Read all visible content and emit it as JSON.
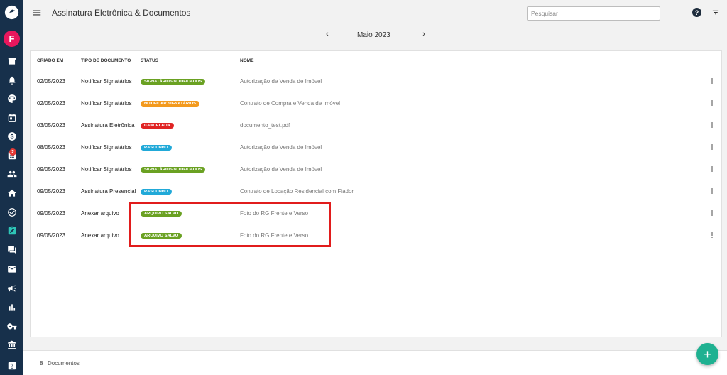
{
  "sidebar": {
    "avatar_letter": "F",
    "notification_count": "2",
    "active_icon": "signature-icon",
    "icons": [
      "store-icon",
      "bell-icon",
      "palette-icon",
      "calendar-icon",
      "dollar-icon",
      "tasks-icon",
      "users-icon",
      "home-icon",
      "check-circle-icon",
      "signature-icon",
      "chat-icon",
      "mail-icon",
      "megaphone-icon",
      "chart-icon",
      "key-icon",
      "bank-icon",
      "help-icon"
    ]
  },
  "header": {
    "title": "Assinatura Eletrônica & Documentos",
    "search_placeholder": "Pesquisar",
    "help_glyph": "?"
  },
  "month_nav": {
    "label": "Maio 2023"
  },
  "table": {
    "columns": [
      "CRIADO EM",
      "TIPO DE DOCUMENTO",
      "STATUS",
      "NOME"
    ],
    "rows": [
      {
        "created": "02/05/2023",
        "type": "Notificar Signatários",
        "status": "SIGNATÁRIOS NOTIFICADOS",
        "status_color": "#6aa122",
        "name": "Autorização de Venda de Imóvel"
      },
      {
        "created": "02/05/2023",
        "type": "Notificar Signatários",
        "status": "NOTIFICAR SIGNATÁRIOS",
        "status_color": "#f39a1e",
        "name": "Contrato de Compra e Venda de Imóvel"
      },
      {
        "created": "03/05/2023",
        "type": "Assinatura Eletrônica",
        "status": "CANCELADA",
        "status_color": "#e02424",
        "name": "documento_test.pdf"
      },
      {
        "created": "08/05/2023",
        "type": "Notificar Signatários",
        "status": "RASCUNHO",
        "status_color": "#21a9d8",
        "name": "Autorização de Venda de Imóvel"
      },
      {
        "created": "09/05/2023",
        "type": "Notificar Signatários",
        "status": "SIGNATÁRIOS NOTIFICADOS",
        "status_color": "#6aa122",
        "name": "Autorização de Venda de Imóvel"
      },
      {
        "created": "09/05/2023",
        "type": "Assinatura Presencial",
        "status": "RASCUNHO",
        "status_color": "#21a9d8",
        "name": "Contrato de Locação Residencial com Fiador"
      },
      {
        "created": "09/05/2023",
        "type": "Anexar arquivo",
        "status": "ARQUIVO SALVO",
        "status_color": "#6aa122",
        "name": "Foto do RG Frente e Verso"
      },
      {
        "created": "09/05/2023",
        "type": "Anexar arquivo",
        "status": "ARQUIVO SALVO",
        "status_color": "#6aa122",
        "name": "Foto do RG Frente e Verso"
      }
    ]
  },
  "footer": {
    "count": "8",
    "count_label": "Documentos"
  },
  "fab": {
    "glyph": "+"
  },
  "colors": {
    "sidebar": "#17304b",
    "accent": "#1fb191",
    "highlight": "#e11c1c"
  }
}
